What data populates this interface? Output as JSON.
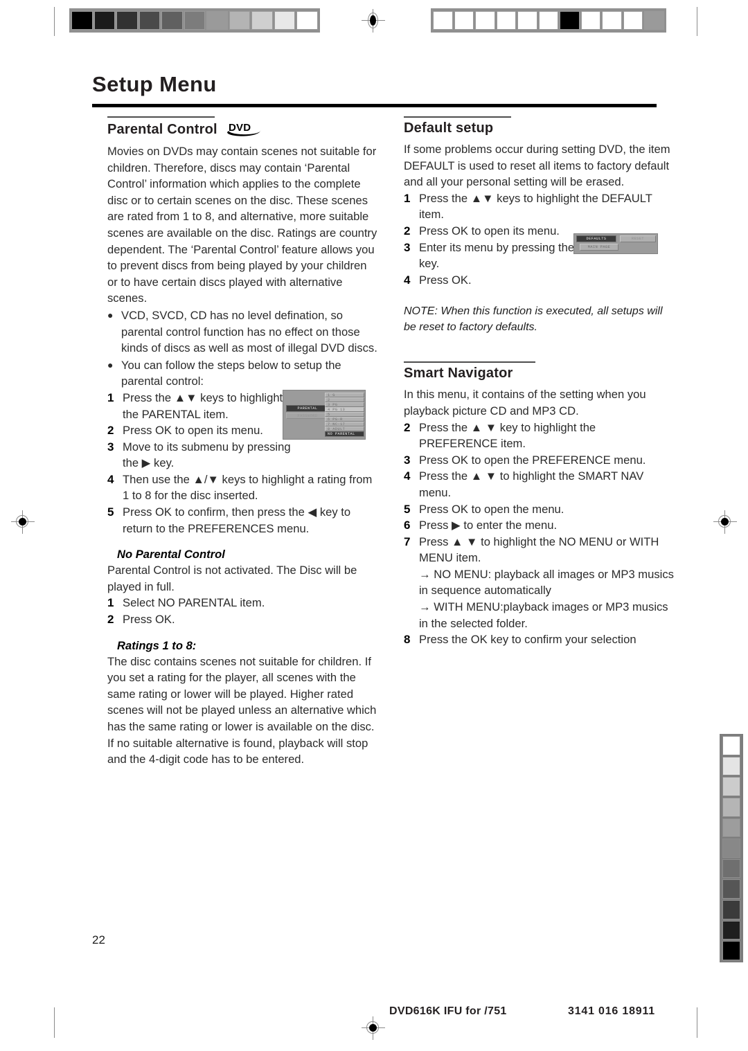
{
  "page": {
    "title": "Setup Menu",
    "number": "22"
  },
  "footer": {
    "left": "DVD616K IFU for /751",
    "right": "3141 016 18911"
  },
  "left_column": {
    "section": {
      "heading": "Parental Control",
      "badge": "DVD"
    },
    "intro": "Movies on DVDs may contain scenes not suitable for children. Therefore, discs may contain ‘Parental Control’ information which applies to the complete disc or to certain scenes on the disc. These scenes are rated from 1 to 8, and alternative, more suitable scenes are available on the disc. Ratings are country dependent. The ‘Parental Control’ feature allows you to prevent discs from being played by your children or to have certain discs played with alternative scenes.",
    "bullets": [
      "VCD, SVCD, CD has no level defination, so parental control function has no effect on those kinds of discs as well as most of  illegal DVD discs.",
      "You can follow the steps below to setup the parental control:"
    ],
    "steps": [
      {
        "num": "1",
        "text": "Press the ▲▼ keys to highlight the PARENTAL item."
      },
      {
        "num": "2",
        "text": "Press OK to open its menu."
      },
      {
        "num": "3",
        "text": "Move to its submenu by pressing the ▶ key."
      },
      {
        "num": "4",
        "text": "Then use the ▲/▼ keys to highlight a rating from 1 to 8 for the disc inserted."
      },
      {
        "num": "5",
        "text": "Press OK to confirm, then press the ◀ key to return to the PREFERENCES menu."
      }
    ],
    "no_parental": {
      "heading": "No Parental Control",
      "body": "Parental Control is not activated. The Disc will be played in full.",
      "steps": [
        {
          "num": "1",
          "text": "Select NO PARENTAL item."
        },
        {
          "num": "2",
          "text": "Press OK."
        }
      ]
    },
    "ratings": {
      "heading": "Ratings 1 to 8:",
      "body": "The disc contains scenes not suitable for children. If you set a rating for the player, all scenes with the same rating or lower will be played. Higher rated scenes will not be played unless an alternative which has the same rating or lower is available on the disc. If no suitable alternative is found, playback will stop and the 4-digit code has to be entered."
    },
    "osd_parental": {
      "selected_item": "PARENTAL",
      "ghost_item": "PASSWORD",
      "items": [
        "1  G",
        "2",
        "3  PG",
        "4  PG  13",
        "5",
        "6  PG-R",
        "7  NC-17",
        "8  ADULT",
        "NO  PARENTAL"
      ],
      "highlighted_index": 3
    }
  },
  "right_column": {
    "default_setup": {
      "heading": "Default setup",
      "body": "If some problems occur during setting DVD, the item DEFAULT is used to reset all items to factory default and all your personal setting will be erased.",
      "steps": [
        {
          "num": "1",
          "text": "Press the ▲▼ keys to highlight the DEFAULT item."
        },
        {
          "num": "2",
          "text": "Press OK to open its menu."
        },
        {
          "num": "3",
          "text": "Enter its menu by pressing the ▶ key."
        },
        {
          "num": "4",
          "text": "Press OK."
        }
      ],
      "note": "NOTE: When this function is executed, all setups will be reset to factory defaults.",
      "osd_defaults": {
        "tab_selected": "DEFAULTS",
        "tab_second": "RESET",
        "tab_third": "MAIN  PAGE"
      }
    },
    "smart_navigator": {
      "heading": "Smart Navigator",
      "body": "In this menu, it contains of the setting when you playback picture CD and MP3 CD.",
      "steps": [
        {
          "num": "2",
          "text": "Press the ▲  ▼ key to highlight the PREFERENCE item."
        },
        {
          "num": "3",
          "text": "Press OK to open the PREFERENCE menu."
        },
        {
          "num": "4",
          "text": "Press the ▲  ▼ to highlight the SMART NAV menu."
        },
        {
          "num": "5",
          "text": "Press OK to open the menu."
        },
        {
          "num": "6",
          "text": "Press ▶ to enter the menu."
        },
        {
          "num": "7",
          "text": "Press ▲  ▼ to highlight the NO MENU or WITH MENU item."
        }
      ],
      "arrow_lines": [
        "→ NO MENU:  playback all images or MP3 musics in sequence automatically",
        "→ WITH MENU:playback images or MP3 musics in the selected folder."
      ],
      "final_step": {
        "num": "8",
        "text": "Press the OK key to confirm your selection"
      }
    }
  },
  "print_marks": {
    "wedge_top_left": [
      "#000000",
      "#1b1b1b",
      "#323232",
      "#4a4a4a",
      "#606060",
      "#7c7c7c",
      "#9a9a9a",
      "#b4b4b4",
      "#cfcfcf",
      "#e8e8e8",
      "#ffffff"
    ],
    "wedge_top_right": [
      "#ffffff",
      "#ffffff",
      "#ffffff",
      "#ffffff",
      "#ffffff",
      "#ffffff",
      "#000000",
      "#ffffff",
      "#ffffff",
      "#ffffff",
      "#9a9a9a"
    ],
    "wedge_right_vertical": [
      "#ffffff",
      "#e4e4e4",
      "#cccccc",
      "#b5b5b5",
      "#9d9d9d",
      "#888888",
      "#6f6f6f",
      "#565656",
      "#3b3b3b",
      "#1f1f1f",
      "#000000"
    ]
  }
}
